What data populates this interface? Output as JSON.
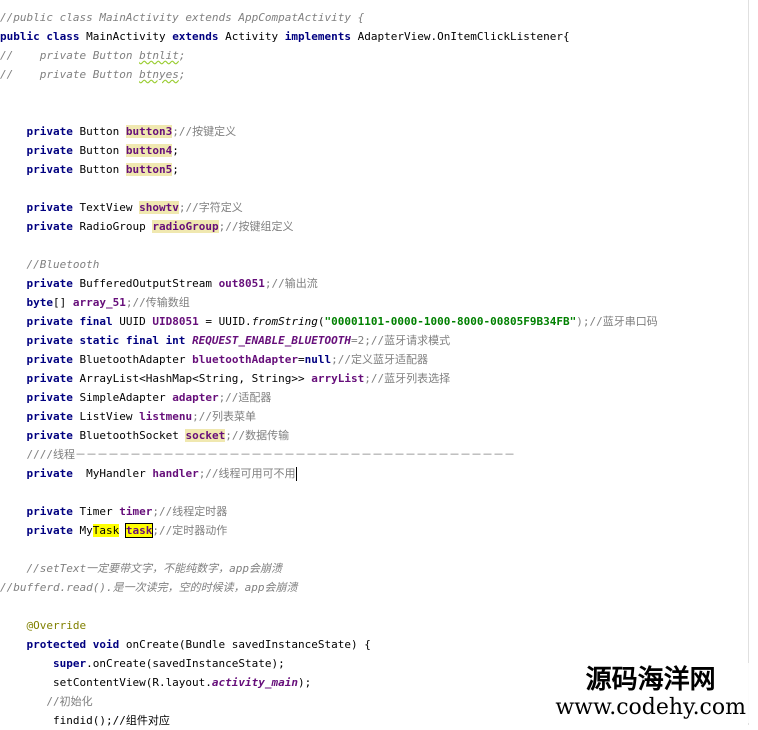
{
  "lines": [
    {
      "segments": [
        {
          "t": "//public class MainActivity extends AppCompatActivity {",
          "c": "cm"
        }
      ]
    },
    {
      "segments": [
        {
          "t": "public class ",
          "c": "kw"
        },
        {
          "t": "MainActivity ",
          "c": ""
        },
        {
          "t": "extends ",
          "c": "kw"
        },
        {
          "t": "Activity ",
          "c": ""
        },
        {
          "t": "implements ",
          "c": "kw"
        },
        {
          "t": "AdapterView.OnItemClickListener{",
          "c": ""
        }
      ]
    },
    {
      "segments": [
        {
          "t": "//    private Button ",
          "c": "cm"
        },
        {
          "t": "btnlit",
          "c": "cm und"
        },
        {
          "t": ";",
          "c": "cm"
        }
      ]
    },
    {
      "segments": [
        {
          "t": "//    private Button ",
          "c": "cm"
        },
        {
          "t": "btnyes",
          "c": "cm und"
        },
        {
          "t": ";",
          "c": "cm"
        }
      ]
    },
    {
      "segments": [
        {
          "t": "",
          "c": ""
        }
      ]
    },
    {
      "segments": [
        {
          "t": "",
          "c": ""
        }
      ]
    },
    {
      "segments": [
        {
          "t": "    private ",
          "c": "kw"
        },
        {
          "t": "Button ",
          "c": ""
        },
        {
          "t": "button3",
          "c": "fld hl"
        },
        {
          "t": ";//按键定义",
          "c": "cmz"
        }
      ]
    },
    {
      "segments": [
        {
          "t": "    private ",
          "c": "kw"
        },
        {
          "t": "Button ",
          "c": ""
        },
        {
          "t": "button4",
          "c": "fld hl"
        },
        {
          "t": ";",
          "c": ""
        }
      ]
    },
    {
      "segments": [
        {
          "t": "    private ",
          "c": "kw"
        },
        {
          "t": "Button ",
          "c": ""
        },
        {
          "t": "button5",
          "c": "fld hl"
        },
        {
          "t": ";",
          "c": ""
        }
      ]
    },
    {
      "segments": [
        {
          "t": "",
          "c": ""
        }
      ]
    },
    {
      "segments": [
        {
          "t": "    private ",
          "c": "kw"
        },
        {
          "t": "TextView ",
          "c": ""
        },
        {
          "t": "showtv",
          "c": "fld hl"
        },
        {
          "t": ";//字符定义",
          "c": "cmz"
        }
      ]
    },
    {
      "segments": [
        {
          "t": "    private ",
          "c": "kw"
        },
        {
          "t": "RadioGroup ",
          "c": ""
        },
        {
          "t": "radioGroup",
          "c": "fld hl"
        },
        {
          "t": ";//按键组定义",
          "c": "cmz"
        }
      ]
    },
    {
      "segments": [
        {
          "t": "",
          "c": ""
        }
      ]
    },
    {
      "segments": [
        {
          "t": "    //Bluetooth",
          "c": "cm"
        }
      ]
    },
    {
      "segments": [
        {
          "t": "    private ",
          "c": "kw"
        },
        {
          "t": "BufferedOutputStream ",
          "c": ""
        },
        {
          "t": "out8051",
          "c": "fld"
        },
        {
          "t": ";//输出流",
          "c": "cmz"
        }
      ]
    },
    {
      "segments": [
        {
          "t": "    byte",
          "c": "kw"
        },
        {
          "t": "[] ",
          "c": ""
        },
        {
          "t": "array_51",
          "c": "fld"
        },
        {
          "t": ";//传输数组",
          "c": "cmz"
        }
      ]
    },
    {
      "segments": [
        {
          "t": "    private final ",
          "c": "kw"
        },
        {
          "t": "UUID ",
          "c": ""
        },
        {
          "t": "UID8051",
          "c": "fld"
        },
        {
          "t": " = UUID.",
          "c": ""
        },
        {
          "t": "fromString",
          "c": "it"
        },
        {
          "t": "(",
          "c": ""
        },
        {
          "t": "\"00001101-0000-1000-8000-00805F9B34FB\"",
          "c": "str"
        },
        {
          "t": ");//蓝牙串口码",
          "c": "cmz"
        }
      ]
    },
    {
      "segments": [
        {
          "t": "    private static final int ",
          "c": "kw"
        },
        {
          "t": "REQUEST_ENABLE_BLUETOOTH",
          "c": "fld it"
        },
        {
          "t": "=2;//蓝牙请求模式",
          "c": "cmz"
        }
      ]
    },
    {
      "segments": [
        {
          "t": "    private ",
          "c": "kw"
        },
        {
          "t": "BluetoothAdapter ",
          "c": ""
        },
        {
          "t": "bluetoothAdapter",
          "c": "fld"
        },
        {
          "t": "=",
          "c": ""
        },
        {
          "t": "null",
          "c": "kw"
        },
        {
          "t": ";//定义蓝牙适配器",
          "c": "cmz"
        }
      ]
    },
    {
      "segments": [
        {
          "t": "    private ",
          "c": "kw"
        },
        {
          "t": "ArrayList<HashMap<String, String>> ",
          "c": ""
        },
        {
          "t": "arryList",
          "c": "fld"
        },
        {
          "t": ";//蓝牙列表选择",
          "c": "cmz"
        }
      ]
    },
    {
      "segments": [
        {
          "t": "    private ",
          "c": "kw"
        },
        {
          "t": "SimpleAdapter ",
          "c": ""
        },
        {
          "t": "adapter",
          "c": "fld"
        },
        {
          "t": ";//适配器",
          "c": "cmz"
        }
      ]
    },
    {
      "segments": [
        {
          "t": "    private ",
          "c": "kw"
        },
        {
          "t": "ListView ",
          "c": ""
        },
        {
          "t": "listmenu",
          "c": "fld"
        },
        {
          "t": ";//列表菜单",
          "c": "cmz"
        }
      ]
    },
    {
      "segments": [
        {
          "t": "    private ",
          "c": "kw"
        },
        {
          "t": "BluetoothSocket ",
          "c": ""
        },
        {
          "t": "socket",
          "c": "fld hl"
        },
        {
          "t": ";//数据传输",
          "c": "cmz"
        }
      ]
    },
    {
      "segments": [
        {
          "t": "    ////线程－－－－－－－－－－－－－－－－－－－－－－－－－－－－－－－－－－－－－－－－",
          "c": "cmz"
        }
      ]
    },
    {
      "segments": [
        {
          "t": "    private  ",
          "c": "kw"
        },
        {
          "t": "MyHandler ",
          "c": ""
        },
        {
          "t": "handler",
          "c": "fld"
        },
        {
          "t": ";//线程可用可不用",
          "c": "cmz"
        }
      ],
      "caret": true,
      "current": true
    },
    {
      "segments": [
        {
          "t": "",
          "c": ""
        }
      ]
    },
    {
      "segments": [
        {
          "t": "    private ",
          "c": "kw"
        },
        {
          "t": "Timer ",
          "c": ""
        },
        {
          "t": "timer",
          "c": "fld"
        },
        {
          "t": ";//线程定时器",
          "c": "cmz"
        }
      ]
    },
    {
      "segments": [
        {
          "t": "    private ",
          "c": "kw"
        },
        {
          "t": "My",
          "c": ""
        },
        {
          "t": "Task",
          "c": "hlY"
        },
        {
          "t": " ",
          "c": ""
        },
        {
          "t": "task",
          "c": "fld hlYb"
        },
        {
          "t": ";//定时器动作",
          "c": "cmz"
        }
      ]
    },
    {
      "segments": [
        {
          "t": "",
          "c": ""
        }
      ]
    },
    {
      "segments": [
        {
          "t": "    //setText一定要带文字，不能纯数字，app会崩溃",
          "c": "cm"
        }
      ]
    },
    {
      "segments": [
        {
          "t": "//bufferd.read().是一次读完，空的时候读，app会崩溃",
          "c": "cm"
        }
      ]
    },
    {
      "segments": [
        {
          "t": "",
          "c": ""
        }
      ]
    },
    {
      "segments": [
        {
          "t": "    @Override",
          "c": "ann"
        }
      ]
    },
    {
      "segments": [
        {
          "t": "    protected void ",
          "c": "kw"
        },
        {
          "t": "onCreate(Bundle savedInstanceState) {",
          "c": ""
        }
      ]
    },
    {
      "segments": [
        {
          "t": "        super",
          "c": "kw"
        },
        {
          "t": ".onCreate(savedInstanceState);",
          "c": ""
        }
      ]
    },
    {
      "segments": [
        {
          "t": "        setContentView(R.layout.",
          "c": ""
        },
        {
          "t": "activity_main",
          "c": "fld it"
        },
        {
          "t": ");",
          "c": ""
        }
      ]
    },
    {
      "segments": [
        {
          "t": "       //初始化",
          "c": "cmz"
        }
      ]
    },
    {
      "segments": [
        {
          "t": "        findid();//组件对应",
          "c": ""
        }
      ]
    }
  ],
  "watermark": {
    "line1": "源码海洋网",
    "line2": "www.codehy.com"
  }
}
